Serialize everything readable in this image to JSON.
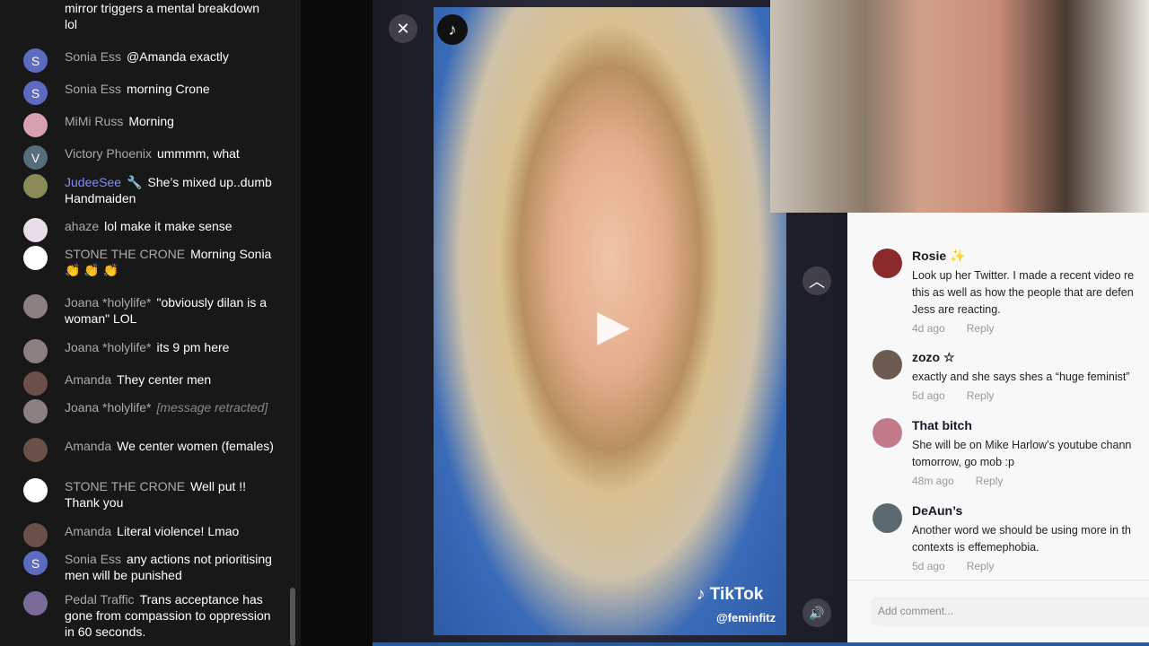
{
  "chat": {
    "messages": [
      {
        "name": "",
        "text": "mirror triggers a mental breakdown lol",
        "avatar": ""
      },
      {
        "name": "Sonia Ess",
        "text": "@Amanda exactly",
        "avatar": "S",
        "color": "#5c6bc0"
      },
      {
        "name": "Sonia Ess",
        "text": "morning Crone",
        "avatar": "S",
        "color": "#5c6bc0"
      },
      {
        "name": "MiMi Russ",
        "text": "Morning",
        "avatar": "",
        "color": "#d9a0b0"
      },
      {
        "name": "Victory Phoenix",
        "text": "ummmm, what",
        "avatar": "V",
        "color": "#546e7a"
      },
      {
        "name": "JudeeSee",
        "badge": "🔧",
        "text": "She’s mixed up..dumb Handmaiden",
        "avatar": "",
        "color": "#8a8a5a",
        "mod": true
      },
      {
        "name": "ahaze",
        "text": "lol make it make sense",
        "avatar": "",
        "color": "#e8dde8"
      },
      {
        "name": "STONE THE CRONE",
        "text": "Morning Sonia 👏 👏 👏",
        "avatar": "",
        "color": "#ffffff"
      },
      {
        "name": "Joana *holylife*",
        "text": "\"obviously dilan is a woman\" LOL",
        "avatar": "",
        "color": "#8a8080"
      },
      {
        "name": "Joana *holylife*",
        "text": "its 9 pm here",
        "avatar": "",
        "color": "#8a8080"
      },
      {
        "name": "Amanda",
        "text": "They center men",
        "avatar": "",
        "color": "#6a5048"
      },
      {
        "name": "Joana *holylife*",
        "text": "[message retracted]",
        "retracted": true,
        "avatar": "",
        "color": "#8a8080"
      },
      {
        "name": "Amanda",
        "text": "We center women (females)",
        "avatar": "",
        "color": "#6a5048"
      },
      {
        "name": "STONE THE CRONE",
        "text": "Well put !! Thank you",
        "avatar": "",
        "color": "#ffffff"
      },
      {
        "name": "Amanda",
        "text": "Literal violence! Lmao",
        "avatar": "",
        "color": "#6a5048"
      },
      {
        "name": "Sonia Ess",
        "text": "any actions not prioritising men will be punished",
        "avatar": "S",
        "color": "#5c6bc0"
      },
      {
        "name": "Pedal Traffic",
        "text": "Trans acceptance has gone from compassion to oppression in 60 seconds.",
        "avatar": "",
        "color": "#7a6a9a"
      }
    ]
  },
  "video": {
    "close": "✕",
    "up": "︿",
    "play": "▶",
    "sound": "🔊",
    "logo": "♪ TikTok",
    "handle": "@feminfitz",
    "badge": "♪"
  },
  "comments": {
    "items": [
      {
        "name": "Rosie ✨",
        "lines": [
          "Look up her Twitter. I made a recent video re",
          "this as well as how the people that are defen",
          "Jess are reacting."
        ],
        "time": "4d ago",
        "reply": "Reply",
        "color": "#8a2a2a"
      },
      {
        "name": "zozo ☆",
        "lines": [
          "exactly and she says shes a “huge feminist”"
        ],
        "time": "5d ago",
        "reply": "Reply",
        "color": "#6a5a50"
      },
      {
        "name": "That bitch",
        "lines": [
          "She will be on Mike Harlow’s youtube chann",
          "tomorrow, go mob :p"
        ],
        "time": "48m ago",
        "reply": "Reply",
        "color": "#c07a8a"
      },
      {
        "name": "DeAun’s",
        "lines": [
          "Another word we should be using more in th",
          "contexts is effemephobia."
        ],
        "time": "5d ago",
        "reply": "Reply",
        "color": "#5a6a70"
      }
    ],
    "placeholder": "Add comment..."
  }
}
